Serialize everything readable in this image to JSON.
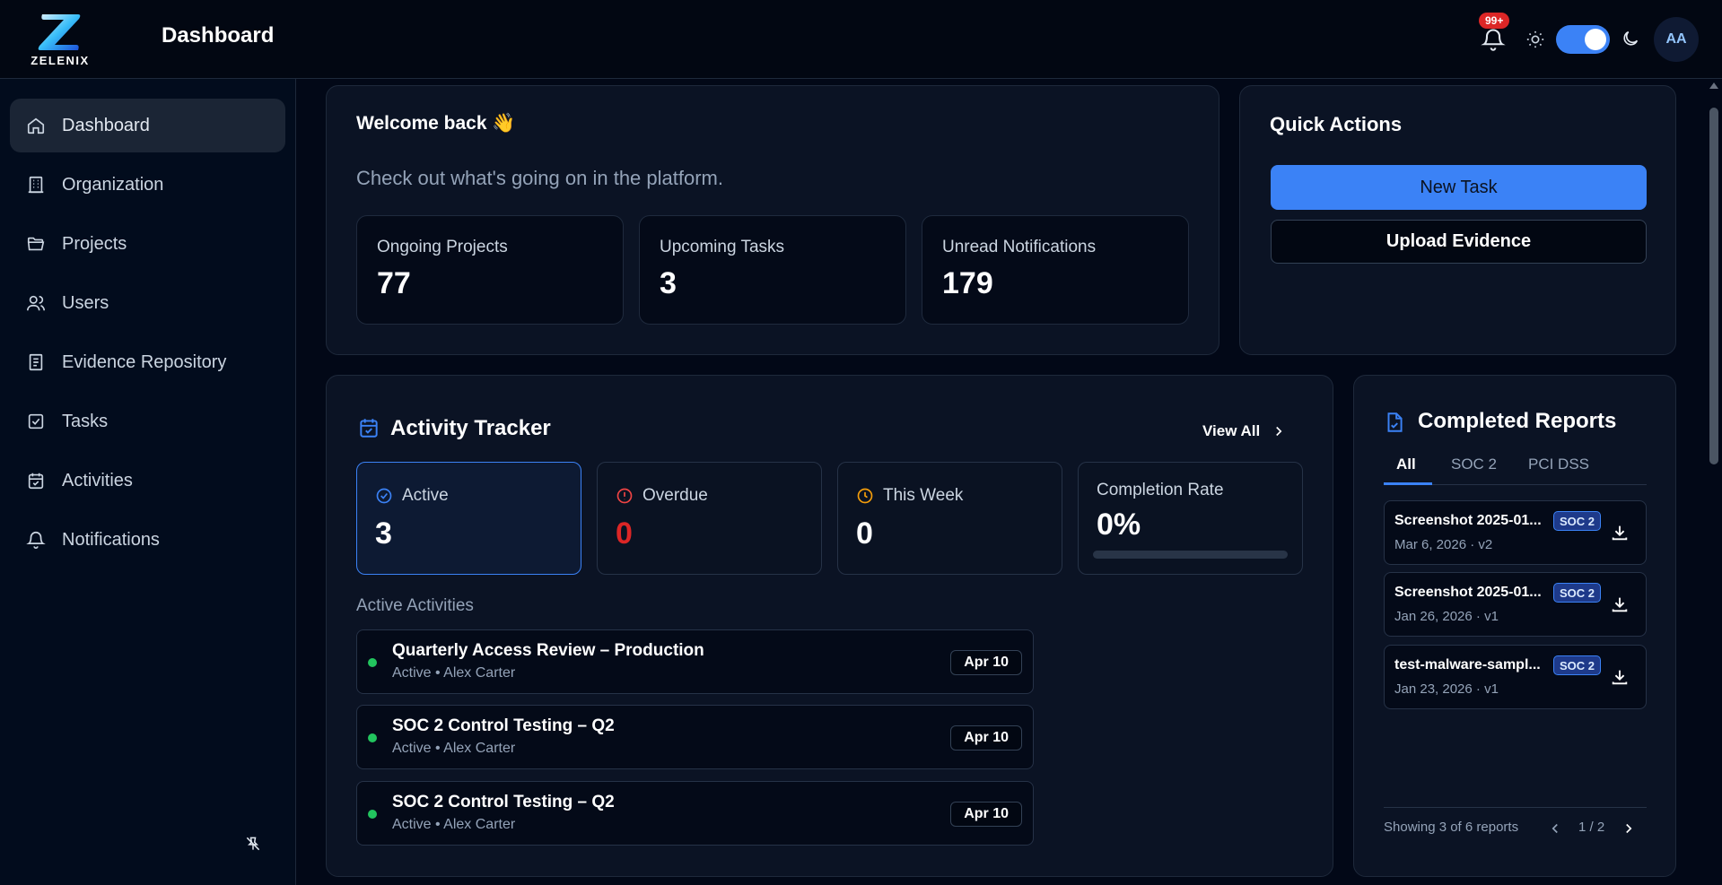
{
  "app": {
    "logo_text": "ZELENIX",
    "page_title": "Dashboard",
    "notification_count": "99+",
    "avatar_initials": "AA",
    "theme_dark": true,
    "accent_color": "#3b82f6"
  },
  "sidebar": {
    "items": [
      {
        "label": "Dashboard",
        "icon": "home-icon"
      },
      {
        "label": "Organization",
        "icon": "building-icon"
      },
      {
        "label": "Projects",
        "icon": "folder-icon"
      },
      {
        "label": "Users",
        "icon": "users-icon"
      },
      {
        "label": "Evidence Repository",
        "icon": "file-text-icon"
      },
      {
        "label": "Tasks",
        "icon": "checkbox-icon"
      },
      {
        "label": "Activities",
        "icon": "calendar-check-icon"
      },
      {
        "label": "Notifications",
        "icon": "bell-icon"
      }
    ]
  },
  "welcome": {
    "title": "Welcome back 👋",
    "subtitle": "Check out what's going on in the platform.",
    "stats": [
      {
        "label": "Ongoing Projects",
        "value": "77"
      },
      {
        "label": "Upcoming Tasks",
        "value": "3"
      },
      {
        "label": "Unread Notifications",
        "value": "179"
      }
    ]
  },
  "quick_actions": {
    "title": "Quick Actions",
    "new_task": "New Task",
    "upload_evidence": "Upload Evidence"
  },
  "activity": {
    "title": "Activity Tracker",
    "view_all": "View All",
    "stats": [
      {
        "label": "Active",
        "value": "3",
        "icon": "check-circle-icon"
      },
      {
        "label": "Overdue",
        "value": "0",
        "icon": "alert-circle-icon"
      },
      {
        "label": "This Week",
        "value": "0",
        "icon": "clock-icon"
      },
      {
        "label": "Completion Rate",
        "value": "0%",
        "progress": 0
      }
    ],
    "section_label": "Active Activities",
    "rows": [
      {
        "title": "Quarterly Access Review – Production",
        "sub": "Active • Alex Carter",
        "date": "Apr 10"
      },
      {
        "title": "SOC 2 Control Testing – Q2",
        "sub": "Active • Alex Carter",
        "date": "Apr 10"
      },
      {
        "title": "SOC 2 Control Testing – Q2",
        "sub": "Active • Alex Carter",
        "date": "Apr 10"
      }
    ]
  },
  "reports": {
    "title": "Completed Reports",
    "tabs": [
      "All",
      "SOC 2",
      "PCI DSS"
    ],
    "items": [
      {
        "title": "Screenshot 2025-01...",
        "sub": "Mar 6, 2026 · v2",
        "badge": "SOC 2"
      },
      {
        "title": "Screenshot 2025-01...",
        "sub": "Jan 26, 2026 · v1",
        "badge": "SOC 2"
      },
      {
        "title": "test-malware-sampl...",
        "sub": "Jan 23, 2026 · v1",
        "badge": "SOC 2"
      }
    ],
    "showing": "Showing 3 of 6 reports",
    "page": "1 / 2"
  }
}
